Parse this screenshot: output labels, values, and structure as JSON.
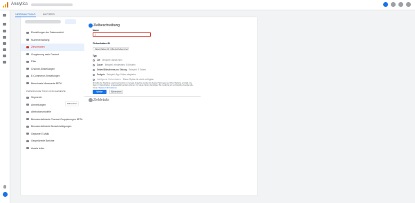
{
  "app": {
    "title": "Analytics"
  },
  "tabs": [
    {
      "label": "VERWALTUNG"
    },
    {
      "label": "NUTZER"
    }
  ],
  "sidebar": {
    "items": [
      {
        "label": "Einstellungen der Datenansicht",
        "icon": "settings-icon"
      },
      {
        "label": "Nutzerverwaltung",
        "icon": "users-icon"
      },
      {
        "label": "Zielvorhaben",
        "icon": "flag-icon",
        "active": true
      },
      {
        "label": "Gruppierung nach Content",
        "icon": "group-icon"
      },
      {
        "label": "Filter",
        "icon": "filter-icon"
      },
      {
        "label": "Channel-Einstellungen",
        "icon": "channel-icon"
      },
      {
        "label": "E-Commerce-Einstellungen",
        "icon": "cart-icon"
      },
      {
        "label": "Berechnete Messwerte BETA",
        "icon": "calc-icon"
      }
    ],
    "section": "PERSÖNLICHE TOOLS UND ELEMENTE",
    "tools": [
      {
        "label": "Segmente",
        "icon": "segments-icon"
      },
      {
        "label": "Anmerkungen",
        "icon": "annotation-icon"
      },
      {
        "label": "Attributionsmodelle",
        "icon": "attribution-icon"
      },
      {
        "label": "Benutzerdefinierte Channel-Gruppierungen BETA",
        "icon": "custom-channel-icon"
      },
      {
        "label": "Benutzerdefinierte Benachrichtigungen",
        "icon": "alert-icon"
      },
      {
        "label": "Geplante E-Mails",
        "icon": "email-icon"
      },
      {
        "label": "Gespeicherte Berichte",
        "icon": "saved-report-icon"
      },
      {
        "label": "Assets teilen",
        "icon": "share-icon"
      }
    ]
  },
  "goal_form": {
    "step1_title": "Zielbeschreibung",
    "name_label": "Name",
    "name_value": "|",
    "slot_label": "Zielvorhaben-ID",
    "slot_value": "Zielvorhaben-ID 1/Zielvorhabengruppe 1",
    "type_label": "Typ",
    "types": [
      {
        "label": "Ziel",
        "desc": "Beispiel: danke.html"
      },
      {
        "label": "Dauer",
        "desc": "Beispiel: mindestens 5 Minuten"
      },
      {
        "label": "Seiten/Bildschirme pro Sitzung",
        "desc": "Beispiel: 3 Seiten"
      },
      {
        "label": "Ereignis",
        "desc": "Beispiel: App-Video abspielen"
      },
      {
        "label": "Intelligente Zielvorhaben",
        "desc": "Diese Option ist nicht verfügbar",
        "disabled": true
      }
    ],
    "note": "Mit Hilfe der Machine-Learning-Funktion in Google Analytics werden die besten Sitzungen auf Ihrer Website ermittelt, die dann in Zielvorhaben umgewandelt werden können. Für diese Option benötigen Sie zunächst ein verknüpftes Google Ads-Konto.",
    "note_link": "Weitere Informationen",
    "continue_label": "Weiter",
    "cancel_label": "Abbrechen",
    "step2_title": "Zieldetails",
    "tooltip": "Abbrechen"
  },
  "colors": {
    "accent": "#1a73e8",
    "error": "#d93025"
  }
}
